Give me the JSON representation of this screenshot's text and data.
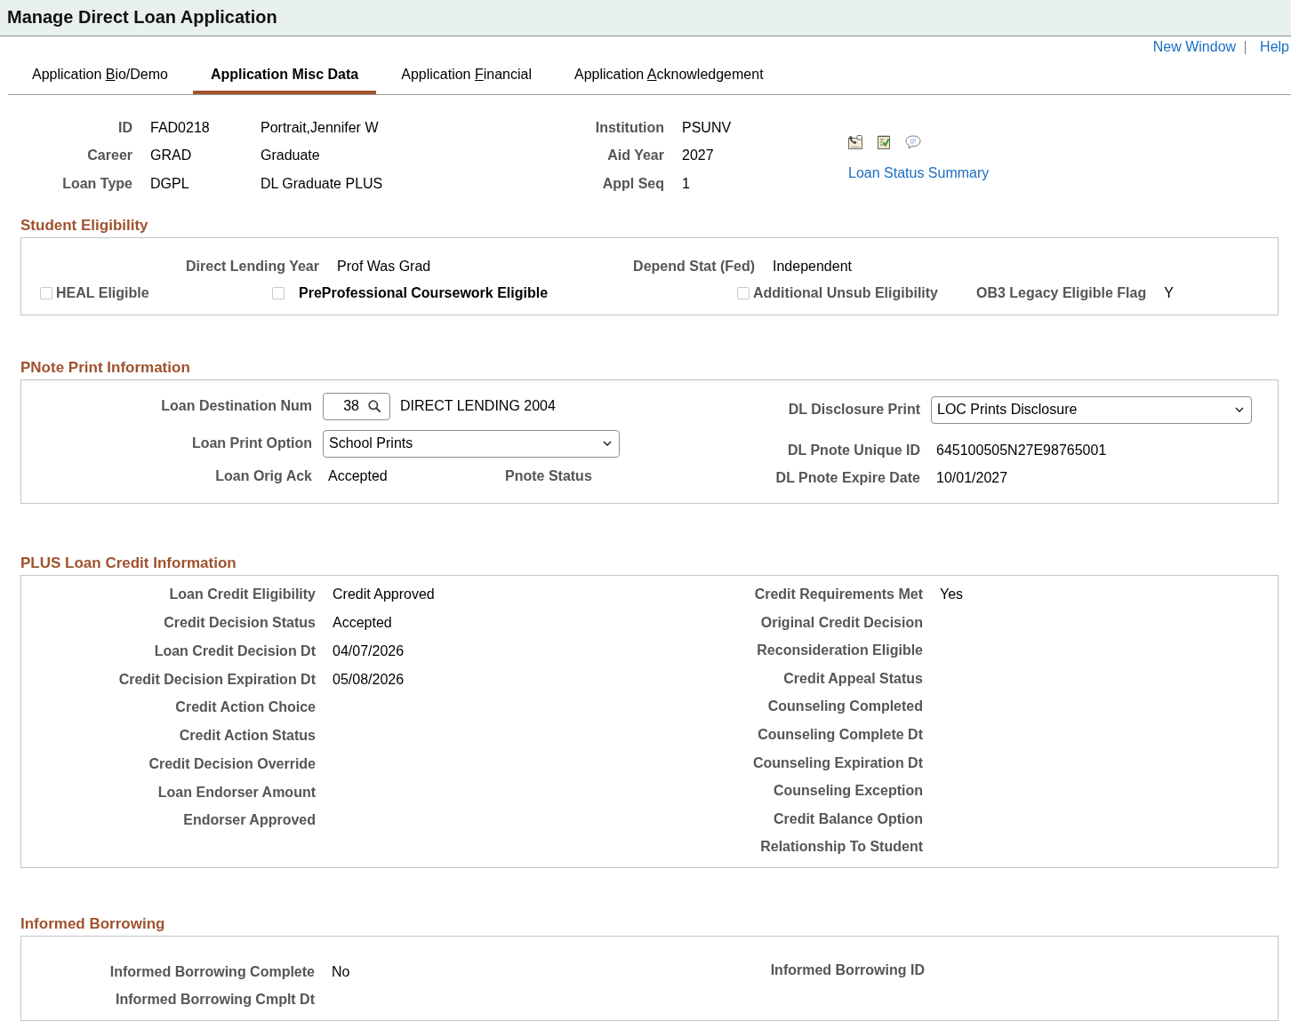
{
  "page_title": "Manage Direct Loan Application",
  "header_links": [
    {
      "label": "New Window"
    },
    {
      "label": "Help"
    }
  ],
  "tabs": [
    {
      "label_before": "Application ",
      "access_key": "B",
      "label_after": "io/Demo",
      "selected": false
    },
    {
      "label": "Application Misc Data",
      "selected": true
    },
    {
      "label_before": "Application ",
      "access_key": "F",
      "label_after": "inancial",
      "selected": false
    },
    {
      "label_before": "Application ",
      "access_key": "A",
      "label_after": "cknowledgement",
      "selected": false
    }
  ],
  "summary": {
    "left": [
      {
        "label": "ID",
        "value": "FAD0218",
        "description": "Portrait,Jennifer W"
      },
      {
        "label": "Career",
        "value": "GRAD",
        "description": "Graduate"
      },
      {
        "label": "Loan Type",
        "value": "DGPL",
        "description": "DL Graduate PLUS"
      }
    ],
    "right": [
      {
        "label": "Institution",
        "value": "PSUNV"
      },
      {
        "label": "Aid Year",
        "value": "2027"
      },
      {
        "label": "Appl Seq",
        "value": "1"
      }
    ],
    "link": "Loan Status Summary"
  },
  "student_eligibility": {
    "title": "Student Eligibility",
    "fields": [
      {
        "label": "Direct Lending Year",
        "value": "Prof Was Grad"
      },
      {
        "label": "Depend Stat (Fed)",
        "value": "Independent"
      }
    ],
    "flags": [
      {
        "kind": "checkbox",
        "label": "HEAL Eligible",
        "checked": false,
        "emphasized": false
      },
      {
        "kind": "checkbox",
        "label": "PreProfessional Coursework Eligible",
        "checked": false,
        "emphasized": true
      },
      {
        "kind": "checkbox",
        "label": "Additional Unsub Eligibility",
        "checked": false,
        "emphasized": false
      },
      {
        "kind": "field",
        "label": "OB3 Legacy Eligible Flag",
        "value": "Y"
      }
    ]
  },
  "pnote_print": {
    "title": "PNote Print Information",
    "left": [
      {
        "kind": "lookup",
        "label": "Loan Destination Num",
        "value": "38",
        "description": "DIRECT LENDING 2004"
      },
      {
        "kind": "select",
        "label": "Loan Print Option",
        "value": "School Prints"
      },
      {
        "kind": "text",
        "label": "Loan Orig Ack",
        "value": "Accepted",
        "side_label": "Pnote Status"
      }
    ],
    "right": [
      {
        "kind": "select",
        "label": "DL Disclosure Print",
        "value": "LOC Prints Disclosure"
      },
      {
        "kind": "text",
        "label": "DL Pnote Unique ID",
        "value": "645100505N27E98765001"
      },
      {
        "kind": "text",
        "label": "DL Pnote Expire Date",
        "value": "10/01/2027"
      }
    ]
  },
  "plus_loan_credit": {
    "title": "PLUS Loan Credit Information",
    "left": [
      {
        "label": "Loan Credit Eligibility",
        "value": "Credit Approved"
      },
      {
        "label": "Credit Decision Status",
        "value": "Accepted"
      },
      {
        "label": "Loan Credit Decision Dt",
        "value": "04/07/2026"
      },
      {
        "label": "Credit Decision Expiration Dt",
        "value": "05/08/2026"
      },
      {
        "label": "Credit Action Choice"
      },
      {
        "label": "Credit Action Status"
      },
      {
        "label": "Credit Decision Override"
      },
      {
        "label": "Loan Endorser Amount"
      },
      {
        "label": "Endorser Approved"
      }
    ],
    "right": [
      {
        "label": "Credit Requirements Met",
        "value": "Yes"
      },
      {
        "label": "Original Credit Decision"
      },
      {
        "label": "Reconsideration Eligible"
      },
      {
        "label": "Credit Appeal Status"
      },
      {
        "label": "Counseling Completed"
      },
      {
        "label": "Counseling Complete Dt"
      },
      {
        "label": "Counseling Expiration Dt"
      },
      {
        "label": "Counseling Exception"
      },
      {
        "label": "Credit Balance Option"
      },
      {
        "label": "Relationship To Student"
      }
    ]
  },
  "informed_borrowing": {
    "title": "Informed Borrowing",
    "left": [
      {
        "label": "Informed Borrowing Complete",
        "value": "No"
      },
      {
        "label": "Informed Borrowing Cmplt Dt"
      }
    ],
    "right": [
      {
        "label": "Informed Borrowing ID"
      }
    ]
  }
}
